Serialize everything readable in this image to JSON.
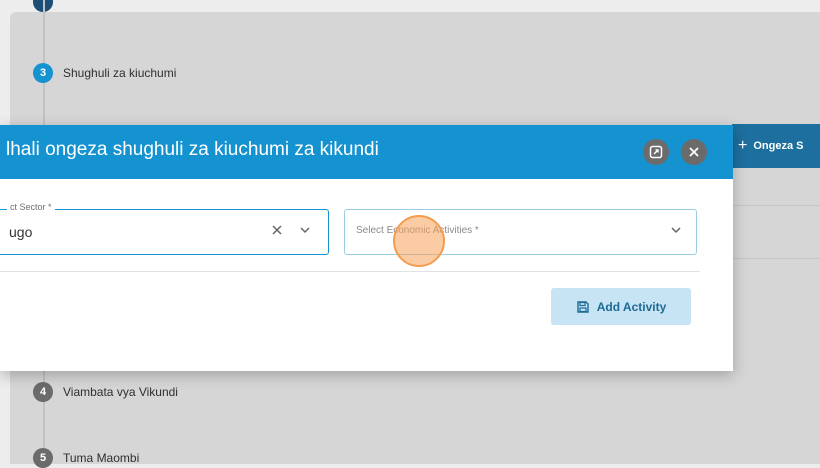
{
  "background": {
    "steps": [
      {
        "number": "3",
        "label": "Shughuli za kiuchumi",
        "color": "#1592d0"
      },
      {
        "number": "4",
        "label": "Viambata vya Vikundi",
        "color": "#6b6b6b"
      },
      {
        "number": "5",
        "label": "Tuma Maombi",
        "color": "#6b6b6b"
      }
    ],
    "add_button_label": "Ongeza S"
  },
  "modal": {
    "title": "lhali ongeza shughuli za kiuchumi za kikundi",
    "sector_field": {
      "legend": "ct Sector *",
      "value": "ugo"
    },
    "activities_field": {
      "placeholder": "Select Economic Activities *"
    },
    "add_activity_label": "Add Activity",
    "header_color": "#1592d0"
  }
}
